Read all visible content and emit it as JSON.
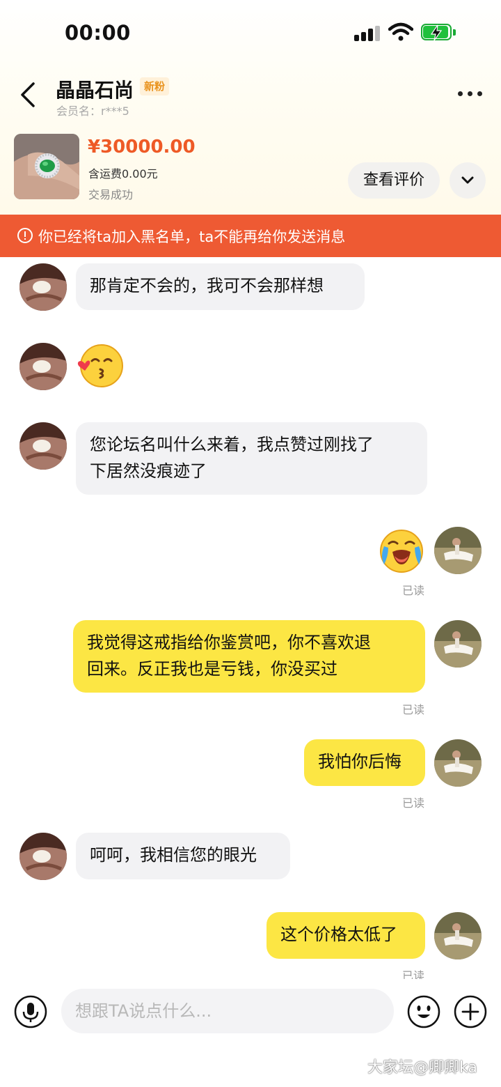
{
  "status_bar": {
    "time": "00:00"
  },
  "header": {
    "contact_name": "晶晶石尚",
    "fan_badge": "新粉",
    "member_id": "会员名：r***5"
  },
  "order": {
    "price": "¥30000.00",
    "shipping": "含运费0.00元",
    "status": "交易成功",
    "review_button": "查看评价"
  },
  "notice": {
    "text": "你已经将ta加入黑名单，ta不能再给你发送消息"
  },
  "messages": [
    {
      "side": "left",
      "text": "那肯定不会的，我可不会那样想"
    },
    {
      "side": "left",
      "emoji": "kissing-face-emoji"
    },
    {
      "side": "left",
      "line1": "您论坛名叫什么来着，我点赞过刚找了",
      "line2": "下居然没痕迹了"
    },
    {
      "side": "right",
      "emoji": "crying-face-emoji",
      "read": "已读"
    },
    {
      "side": "right",
      "line1": "我觉得这戒指给你鉴赏吧，你不喜欢退",
      "line2": "回来。反正我也是亏钱，你没买过",
      "read": "已读"
    },
    {
      "side": "right",
      "text": "我怕你后悔",
      "read": "已读"
    },
    {
      "side": "left",
      "text": "呵呵，我相信您的眼光"
    },
    {
      "side": "right",
      "text": "这个价格太低了",
      "read": "已读"
    }
  ],
  "input": {
    "placeholder": "想跟TA说点什么..."
  },
  "watermark": "大家坛@卿卿ka"
}
